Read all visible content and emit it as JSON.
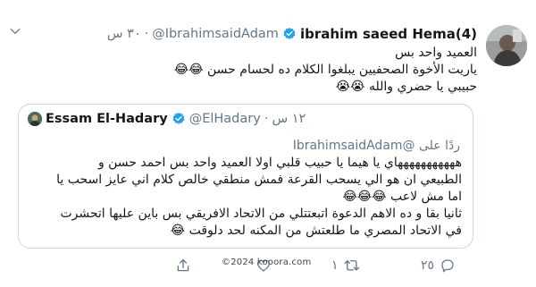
{
  "tweet": {
    "author_name": "ibrahim saeed Hema(4)",
    "author_handle": "@IbrahimsaidAdam",
    "dot": "·",
    "time": "٣٠ س",
    "lines": [
      "العميد واحد بس",
      "ياريت الأخوة الصحفيين يبلغوا الكلام ده لحسام حسن 😂😂",
      "حبيبي يا حضري والله 😭😭"
    ]
  },
  "quote": {
    "author_name": "Essam El-Hadary",
    "author_handle": "@ElHadary",
    "dot": "·",
    "time": "١٢ س",
    "reply_to": "ردًا على @IbrahimsaidAdam",
    "lines": [
      "هههههههههههاي يا هيما يا حبيب قلبي اولا العميد واحد بس احمد حسن و",
      "الطبيعي ان هو الي يسحب القرعة فمش منطقي خالص كلام اني عايز اسحب يا",
      "اما مش لاعب 😂😂😂",
      "ثانيا بقا و ده الاهم الدعوة اتبعتتلي من الاتحاد الافريقي بس باين عليها اتحشرت",
      "في الاتحاد المصري ما طلعتش من المكنه لحد دلوقت 😂"
    ]
  },
  "actions": {
    "reply_count": "٢٥",
    "retweet_count": "١",
    "like_count": "",
    "share_count": ""
  },
  "watermark": "©2024 kooora.com",
  "icons": {
    "verified": "verified-badge-icon",
    "chevron": "chevron-down-icon",
    "reply": "reply-icon",
    "retweet": "retweet-icon",
    "like": "heart-icon",
    "share": "share-icon"
  },
  "colors": {
    "verified": "#1da1f2",
    "muted": "#657786",
    "border": "#ccd6dd",
    "text": "#14171a"
  }
}
